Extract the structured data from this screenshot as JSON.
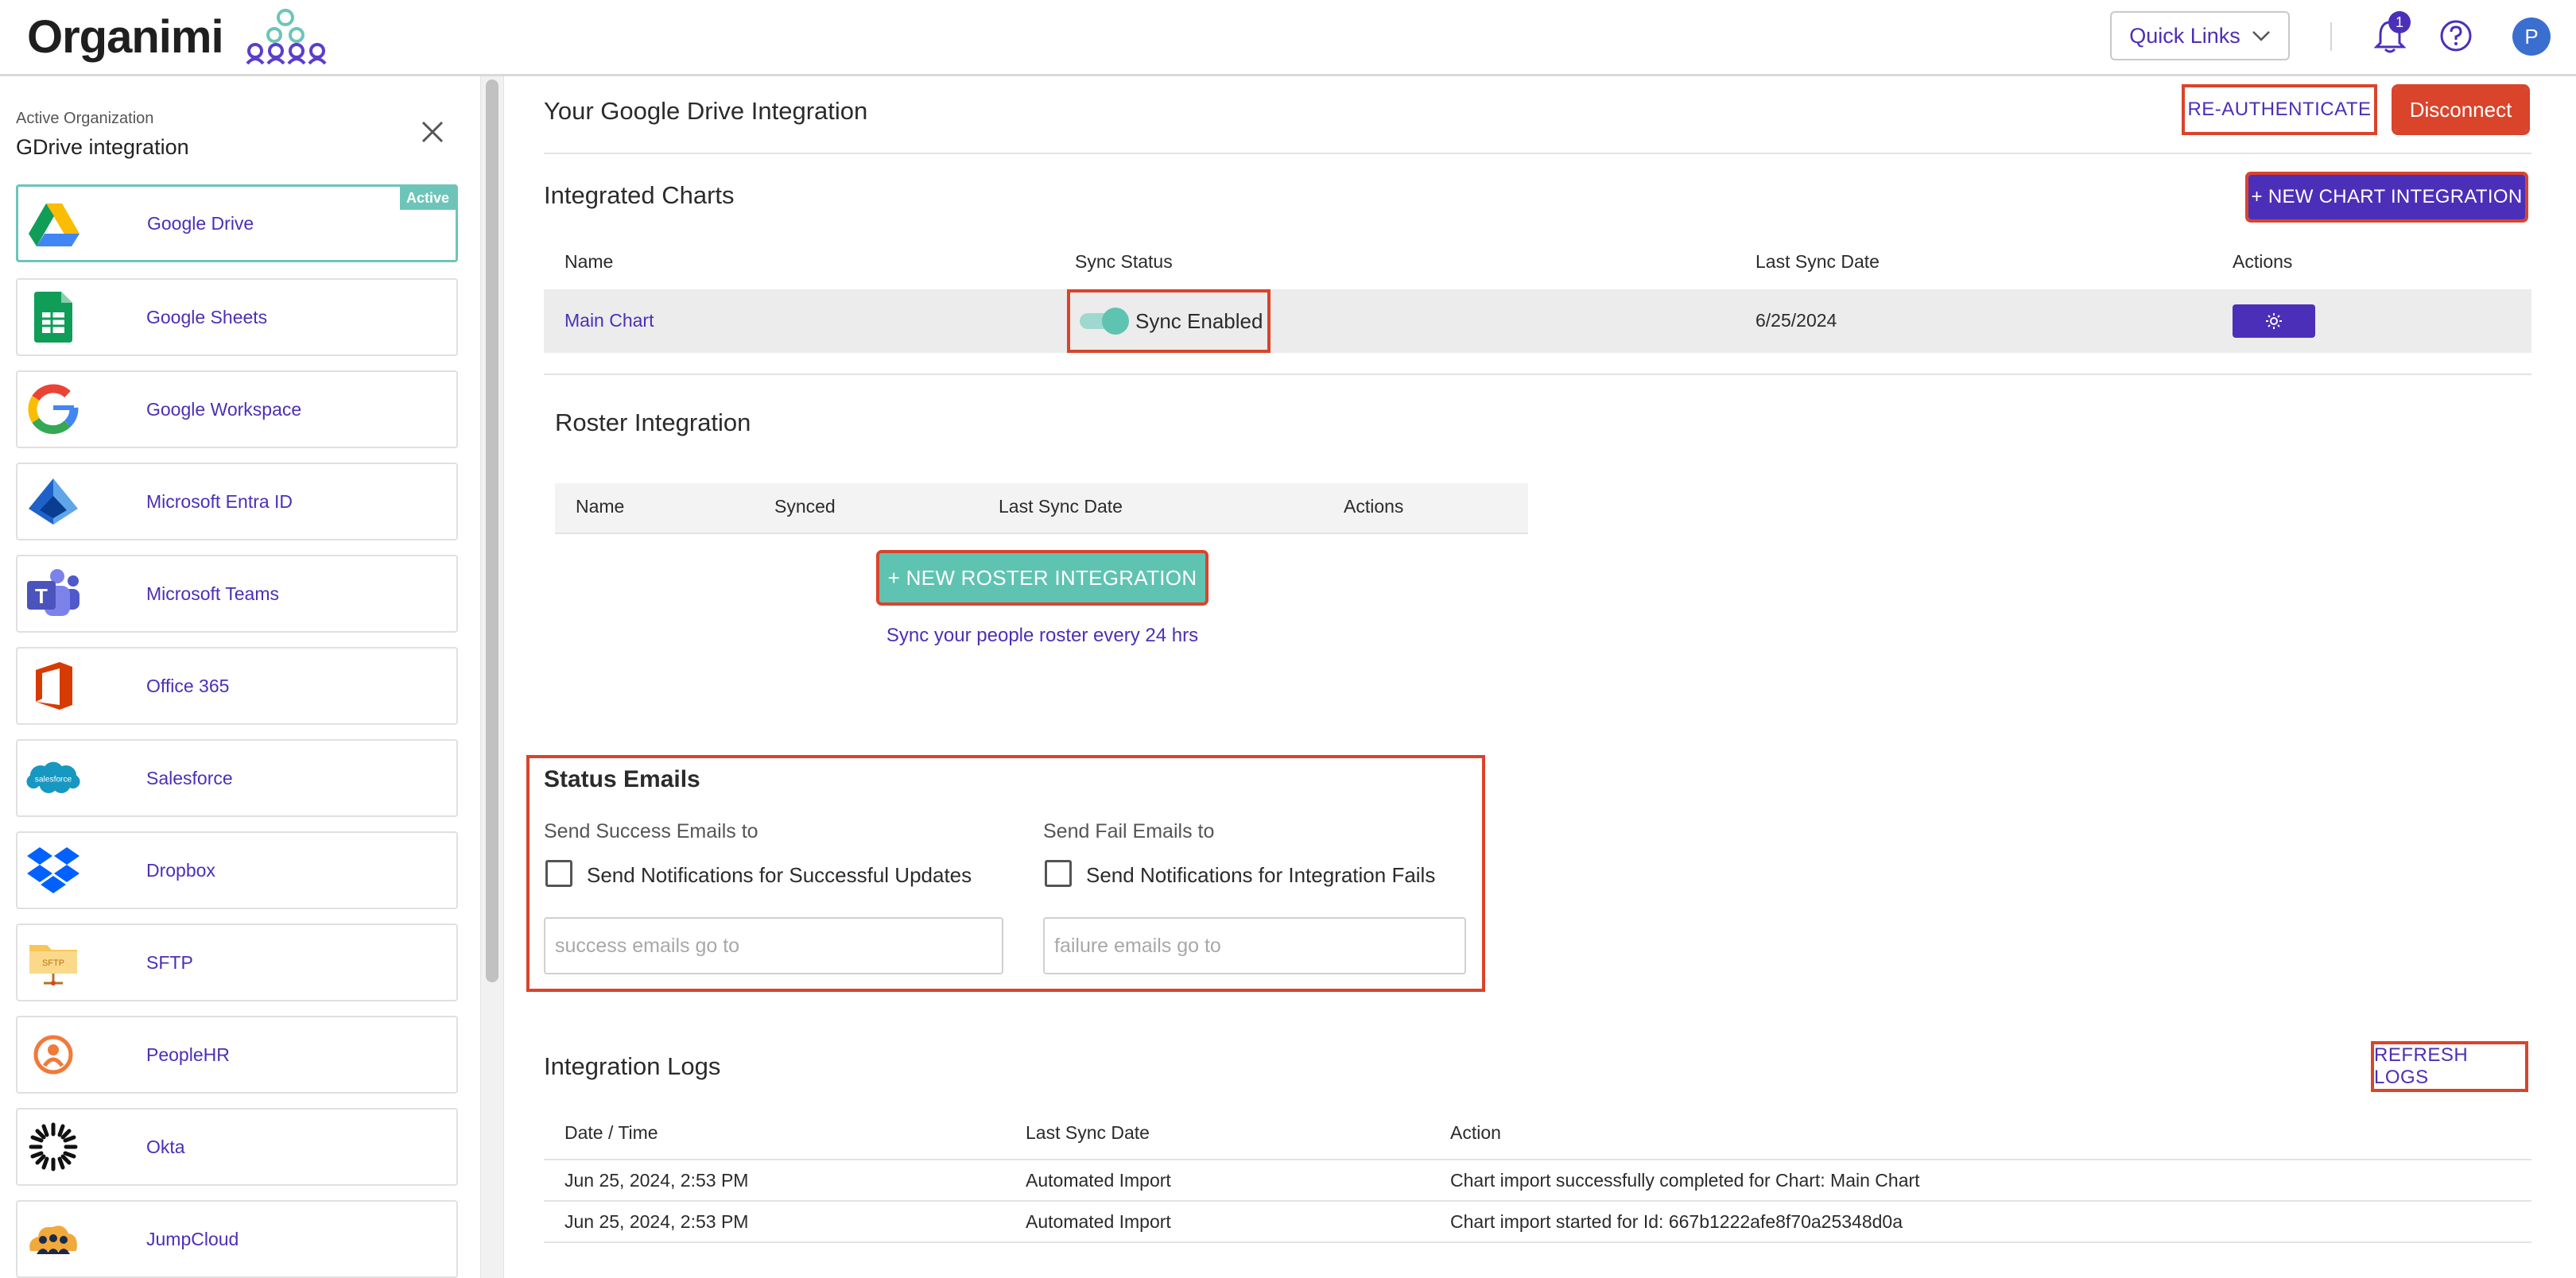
{
  "app": {
    "logo_text": "Organimi"
  },
  "header": {
    "quick_links_label": "Quick Links",
    "notification_count": "1",
    "avatar_initial": "P",
    "icons": {
      "bell": "bell-icon",
      "help": "help-icon",
      "chevron": "chevron-down-icon"
    }
  },
  "sidebar": {
    "org_label": "Active Organization",
    "org_name": "GDrive integration",
    "active_badge": "Active",
    "items": [
      {
        "label": "Google Drive",
        "icon": "google-drive-icon",
        "active": true
      },
      {
        "label": "Google Sheets",
        "icon": "google-sheets-icon"
      },
      {
        "label": "Google Workspace",
        "icon": "google-workspace-icon"
      },
      {
        "label": "Microsoft Entra ID",
        "icon": "microsoft-entra-icon"
      },
      {
        "label": "Microsoft Teams",
        "icon": "microsoft-teams-icon"
      },
      {
        "label": "Office 365",
        "icon": "office-365-icon"
      },
      {
        "label": "Salesforce",
        "icon": "salesforce-icon"
      },
      {
        "label": "Dropbox",
        "icon": "dropbox-icon"
      },
      {
        "label": "SFTP",
        "icon": "sftp-icon"
      },
      {
        "label": "PeopleHR",
        "icon": "peoplehr-icon"
      },
      {
        "label": "Okta",
        "icon": "okta-icon"
      },
      {
        "label": "JumpCloud",
        "icon": "jumpcloud-icon"
      }
    ],
    "sftp_icon_text": "SFTP",
    "salesforce_icon_text": "salesforce",
    "teams_icon_text": "T"
  },
  "integration": {
    "title": "Your Google Drive Integration",
    "reauth_label": "RE-AUTHENTICATE",
    "disconnect_label": "Disconnect"
  },
  "charts": {
    "title": "Integrated Charts",
    "new_button": "+ NEW CHART INTEGRATION",
    "columns": [
      "Name",
      "Sync Status",
      "Last Sync Date",
      "Actions"
    ],
    "rows": [
      {
        "name": "Main Chart",
        "sync_status": "Sync Enabled",
        "sync_on": true,
        "last_sync": "6/25/2024"
      }
    ]
  },
  "roster": {
    "title": "Roster Integration",
    "columns": [
      "Name",
      "Synced",
      "Last Sync Date",
      "Actions"
    ],
    "new_button": "+ NEW ROSTER INTEGRATION",
    "hint": "Sync your people roster every 24 hrs"
  },
  "status_emails": {
    "title": "Status Emails",
    "success_label": "Send Success Emails to",
    "success_checkbox": "Send Notifications for Successful Updates",
    "success_placeholder": "success emails go to",
    "fail_label": "Send Fail Emails to",
    "fail_checkbox": "Send Notifications for Integration Fails",
    "fail_placeholder": "failure emails go to"
  },
  "logs": {
    "title": "Integration Logs",
    "refresh_label": "REFRESH LOGS",
    "columns": [
      "Date / Time",
      "Last Sync Date",
      "Action"
    ],
    "rows": [
      {
        "datetime": "Jun 25, 2024, 2:53 PM",
        "sync": "Automated Import",
        "action": "Chart import successfully completed for Chart: Main Chart"
      },
      {
        "datetime": "Jun 25, 2024, 2:53 PM",
        "sync": "Automated Import",
        "action": "Chart import started for Id: 667b1222afe8f70a25348d0a"
      }
    ]
  },
  "colors": {
    "brand": "#4b2fb8",
    "teal": "#5fc3b2",
    "danger": "#d9442b",
    "highlight": "#d9442b"
  }
}
